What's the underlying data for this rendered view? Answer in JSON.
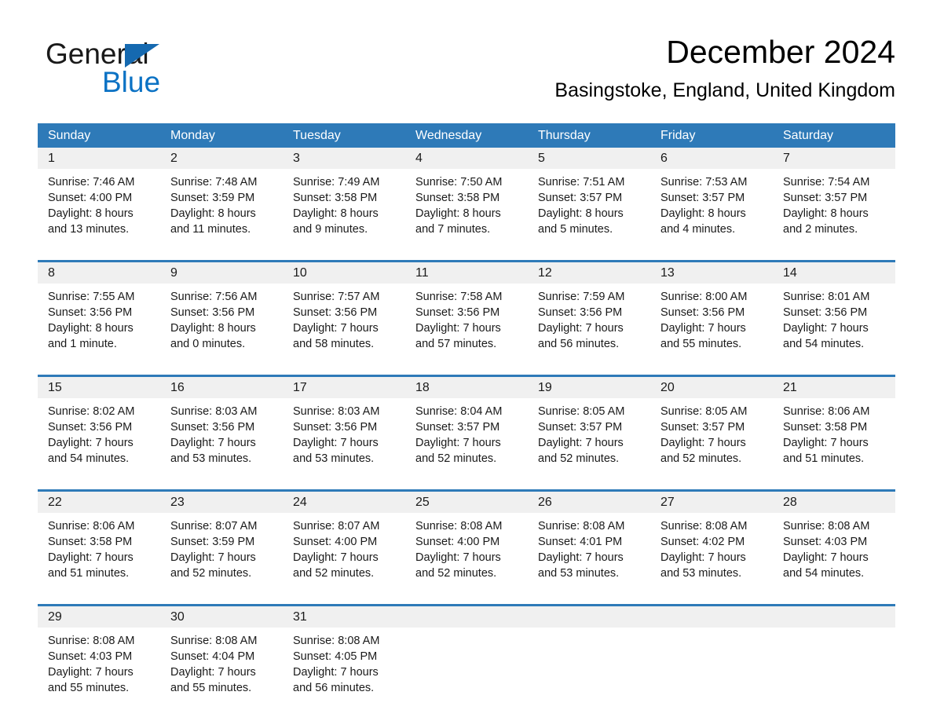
{
  "brand": {
    "word_one": "General",
    "word_two": "Blue",
    "triangle_icon": "triangle-icon",
    "accent_color": "#1569b0",
    "blue_color": "#0b72c4"
  },
  "header": {
    "month_title": "December 2024",
    "location": "Basingstoke, England, United Kingdom"
  },
  "theme": {
    "header_blue": "#2e7ab8",
    "rule_blue": "#2e7ab8",
    "daynum_band": "#f0f0f0",
    "cell_bg": "#ffffff",
    "text": "#1a1a1a"
  },
  "calendar": {
    "day_headers": [
      "Sunday",
      "Monday",
      "Tuesday",
      "Wednesday",
      "Thursday",
      "Friday",
      "Saturday"
    ],
    "weeks": [
      [
        {
          "day": "1",
          "sunrise": "Sunrise: 7:46 AM",
          "sunset": "Sunset: 4:00 PM",
          "daylight_1": "Daylight: 8 hours",
          "daylight_2": "and 13 minutes."
        },
        {
          "day": "2",
          "sunrise": "Sunrise: 7:48 AM",
          "sunset": "Sunset: 3:59 PM",
          "daylight_1": "Daylight: 8 hours",
          "daylight_2": "and 11 minutes."
        },
        {
          "day": "3",
          "sunrise": "Sunrise: 7:49 AM",
          "sunset": "Sunset: 3:58 PM",
          "daylight_1": "Daylight: 8 hours",
          "daylight_2": "and 9 minutes."
        },
        {
          "day": "4",
          "sunrise": "Sunrise: 7:50 AM",
          "sunset": "Sunset: 3:58 PM",
          "daylight_1": "Daylight: 8 hours",
          "daylight_2": "and 7 minutes."
        },
        {
          "day": "5",
          "sunrise": "Sunrise: 7:51 AM",
          "sunset": "Sunset: 3:57 PM",
          "daylight_1": "Daylight: 8 hours",
          "daylight_2": "and 5 minutes."
        },
        {
          "day": "6",
          "sunrise": "Sunrise: 7:53 AM",
          "sunset": "Sunset: 3:57 PM",
          "daylight_1": "Daylight: 8 hours",
          "daylight_2": "and 4 minutes."
        },
        {
          "day": "7",
          "sunrise": "Sunrise: 7:54 AM",
          "sunset": "Sunset: 3:57 PM",
          "daylight_1": "Daylight: 8 hours",
          "daylight_2": "and 2 minutes."
        }
      ],
      [
        {
          "day": "8",
          "sunrise": "Sunrise: 7:55 AM",
          "sunset": "Sunset: 3:56 PM",
          "daylight_1": "Daylight: 8 hours",
          "daylight_2": "and 1 minute."
        },
        {
          "day": "9",
          "sunrise": "Sunrise: 7:56 AM",
          "sunset": "Sunset: 3:56 PM",
          "daylight_1": "Daylight: 8 hours",
          "daylight_2": "and 0 minutes."
        },
        {
          "day": "10",
          "sunrise": "Sunrise: 7:57 AM",
          "sunset": "Sunset: 3:56 PM",
          "daylight_1": "Daylight: 7 hours",
          "daylight_2": "and 58 minutes."
        },
        {
          "day": "11",
          "sunrise": "Sunrise: 7:58 AM",
          "sunset": "Sunset: 3:56 PM",
          "daylight_1": "Daylight: 7 hours",
          "daylight_2": "and 57 minutes."
        },
        {
          "day": "12",
          "sunrise": "Sunrise: 7:59 AM",
          "sunset": "Sunset: 3:56 PM",
          "daylight_1": "Daylight: 7 hours",
          "daylight_2": "and 56 minutes."
        },
        {
          "day": "13",
          "sunrise": "Sunrise: 8:00 AM",
          "sunset": "Sunset: 3:56 PM",
          "daylight_1": "Daylight: 7 hours",
          "daylight_2": "and 55 minutes."
        },
        {
          "day": "14",
          "sunrise": "Sunrise: 8:01 AM",
          "sunset": "Sunset: 3:56 PM",
          "daylight_1": "Daylight: 7 hours",
          "daylight_2": "and 54 minutes."
        }
      ],
      [
        {
          "day": "15",
          "sunrise": "Sunrise: 8:02 AM",
          "sunset": "Sunset: 3:56 PM",
          "daylight_1": "Daylight: 7 hours",
          "daylight_2": "and 54 minutes."
        },
        {
          "day": "16",
          "sunrise": "Sunrise: 8:03 AM",
          "sunset": "Sunset: 3:56 PM",
          "daylight_1": "Daylight: 7 hours",
          "daylight_2": "and 53 minutes."
        },
        {
          "day": "17",
          "sunrise": "Sunrise: 8:03 AM",
          "sunset": "Sunset: 3:56 PM",
          "daylight_1": "Daylight: 7 hours",
          "daylight_2": "and 53 minutes."
        },
        {
          "day": "18",
          "sunrise": "Sunrise: 8:04 AM",
          "sunset": "Sunset: 3:57 PM",
          "daylight_1": "Daylight: 7 hours",
          "daylight_2": "and 52 minutes."
        },
        {
          "day": "19",
          "sunrise": "Sunrise: 8:05 AM",
          "sunset": "Sunset: 3:57 PM",
          "daylight_1": "Daylight: 7 hours",
          "daylight_2": "and 52 minutes."
        },
        {
          "day": "20",
          "sunrise": "Sunrise: 8:05 AM",
          "sunset": "Sunset: 3:57 PM",
          "daylight_1": "Daylight: 7 hours",
          "daylight_2": "and 52 minutes."
        },
        {
          "day": "21",
          "sunrise": "Sunrise: 8:06 AM",
          "sunset": "Sunset: 3:58 PM",
          "daylight_1": "Daylight: 7 hours",
          "daylight_2": "and 51 minutes."
        }
      ],
      [
        {
          "day": "22",
          "sunrise": "Sunrise: 8:06 AM",
          "sunset": "Sunset: 3:58 PM",
          "daylight_1": "Daylight: 7 hours",
          "daylight_2": "and 51 minutes."
        },
        {
          "day": "23",
          "sunrise": "Sunrise: 8:07 AM",
          "sunset": "Sunset: 3:59 PM",
          "daylight_1": "Daylight: 7 hours",
          "daylight_2": "and 52 minutes."
        },
        {
          "day": "24",
          "sunrise": "Sunrise: 8:07 AM",
          "sunset": "Sunset: 4:00 PM",
          "daylight_1": "Daylight: 7 hours",
          "daylight_2": "and 52 minutes."
        },
        {
          "day": "25",
          "sunrise": "Sunrise: 8:08 AM",
          "sunset": "Sunset: 4:00 PM",
          "daylight_1": "Daylight: 7 hours",
          "daylight_2": "and 52 minutes."
        },
        {
          "day": "26",
          "sunrise": "Sunrise: 8:08 AM",
          "sunset": "Sunset: 4:01 PM",
          "daylight_1": "Daylight: 7 hours",
          "daylight_2": "and 53 minutes."
        },
        {
          "day": "27",
          "sunrise": "Sunrise: 8:08 AM",
          "sunset": "Sunset: 4:02 PM",
          "daylight_1": "Daylight: 7 hours",
          "daylight_2": "and 53 minutes."
        },
        {
          "day": "28",
          "sunrise": "Sunrise: 8:08 AM",
          "sunset": "Sunset: 4:03 PM",
          "daylight_1": "Daylight: 7 hours",
          "daylight_2": "and 54 minutes."
        }
      ],
      [
        {
          "day": "29",
          "sunrise": "Sunrise: 8:08 AM",
          "sunset": "Sunset: 4:03 PM",
          "daylight_1": "Daylight: 7 hours",
          "daylight_2": "and 55 minutes."
        },
        {
          "day": "30",
          "sunrise": "Sunrise: 8:08 AM",
          "sunset": "Sunset: 4:04 PM",
          "daylight_1": "Daylight: 7 hours",
          "daylight_2": "and 55 minutes."
        },
        {
          "day": "31",
          "sunrise": "Sunrise: 8:08 AM",
          "sunset": "Sunset: 4:05 PM",
          "daylight_1": "Daylight: 7 hours",
          "daylight_2": "and 56 minutes."
        },
        {
          "day": "",
          "sunrise": "",
          "sunset": "",
          "daylight_1": "",
          "daylight_2": ""
        },
        {
          "day": "",
          "sunrise": "",
          "sunset": "",
          "daylight_1": "",
          "daylight_2": ""
        },
        {
          "day": "",
          "sunrise": "",
          "sunset": "",
          "daylight_1": "",
          "daylight_2": ""
        },
        {
          "day": "",
          "sunrise": "",
          "sunset": "",
          "daylight_1": "",
          "daylight_2": ""
        }
      ]
    ]
  }
}
